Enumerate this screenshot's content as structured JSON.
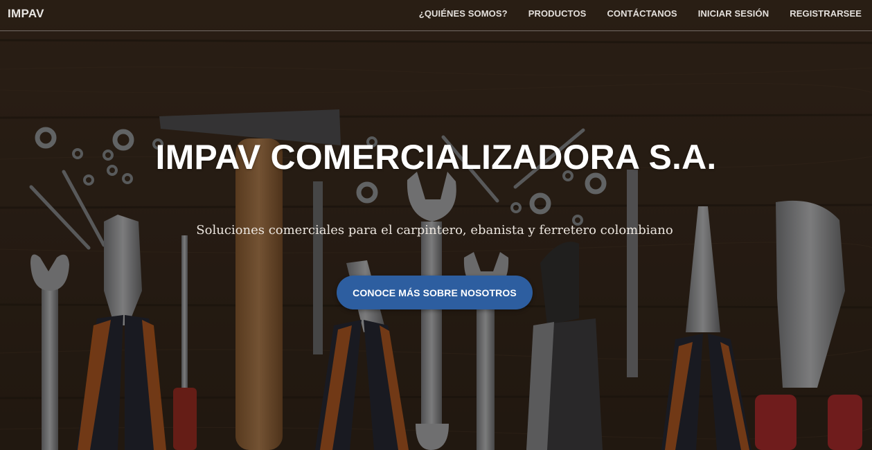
{
  "nav": {
    "brand": "IMPAV",
    "links": [
      {
        "label": "¿QUIÉNES SOMOS?"
      },
      {
        "label": "PRODUCTOS"
      },
      {
        "label": "CONTÁCTANOS"
      },
      {
        "label": "INICIAR SESIÓN"
      },
      {
        "label": "REGISTRARSEE"
      }
    ]
  },
  "hero": {
    "title": "IMPAV COMERCIALIZADORA S.A.",
    "subtitle": "Soluciones comerciales para el carpintero, ebanista y ferretero colombiano",
    "cta_label": "CONOCE MÁS SOBRE NOSOTROS",
    "background": "wooden-table-with-hand-tools-photo"
  },
  "colors": {
    "accent": "#2d5ea0",
    "text": "#ffffff",
    "wood": "#3b2a1c"
  }
}
